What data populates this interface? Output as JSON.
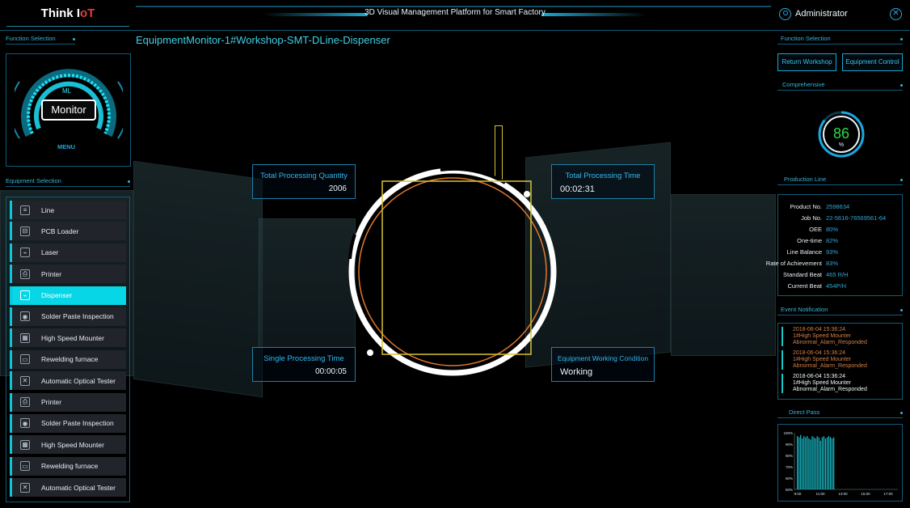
{
  "header": {
    "logo_main": "Think I",
    "logo_accent": "oT",
    "platform_title": "3D Visual Management Platform for Smart Factory",
    "user_name": "Administrator"
  },
  "page_title": "EquipmentMonitor-1#Workshop-SMT-DLine-Dispenser",
  "left": {
    "function_selection": "Function Selection",
    "menu_ml": "ML",
    "menu_monitor": "Monitor",
    "menu_label": "MENU",
    "equipment_selection": "Equipment Selection",
    "equipment": [
      {
        "label": "Line",
        "icon": "line-icon",
        "glyph": "≡"
      },
      {
        "label": "PCB Loader",
        "icon": "pcb-loader-icon",
        "glyph": "⊟"
      },
      {
        "label": "Laser",
        "icon": "laser-icon",
        "glyph": "⌁"
      },
      {
        "label": "Printer",
        "icon": "printer-icon",
        "glyph": "⎙"
      },
      {
        "label": "Dispenser",
        "icon": "dispenser-icon",
        "glyph": "⌁"
      },
      {
        "label": "Solder Paste Inspection",
        "icon": "inspection-icon",
        "glyph": "◉"
      },
      {
        "label": "High Speed Mounter",
        "icon": "mounter-icon",
        "glyph": "▦"
      },
      {
        "label": "Rewelding furnace",
        "icon": "furnace-icon",
        "glyph": "▭"
      },
      {
        "label": "Automatic Optical Tester",
        "icon": "optical-tester-icon",
        "glyph": "✕"
      },
      {
        "label": "Printer",
        "icon": "printer-icon",
        "glyph": "⎙"
      },
      {
        "label": "Solder Paste Inspection",
        "icon": "inspection-icon",
        "glyph": "◉"
      },
      {
        "label": "High Speed Mounter",
        "icon": "mounter-icon",
        "glyph": "▦"
      },
      {
        "label": "Rewelding furnace",
        "icon": "furnace-icon",
        "glyph": "▭"
      },
      {
        "label": "Automatic Optical Tester",
        "icon": "optical-tester-icon",
        "glyph": "✕"
      }
    ],
    "active_index": 4
  },
  "center": {
    "total_qty_title": "Total Processing Quantity",
    "total_qty_value": "2006",
    "total_time_title": "Total Processing Time",
    "total_time_value": "00:02:31",
    "single_time_title": "Single Processing Time",
    "single_time_value": "00:00:05",
    "condition_title": "Equipment Working Condition",
    "condition_value": "Working"
  },
  "right": {
    "function_selection": "Function Selection",
    "return_workshop": "Return Workshop",
    "equipment_control": "Equipment Control",
    "comprehensive": "Comprehensive",
    "gauge_value": "86",
    "gauge_unit": "%",
    "gauge_fraction": 0.86,
    "production_line": "Production Line",
    "production": [
      {
        "k": "Product No.",
        "v": "2598634"
      },
      {
        "k": "Job No.",
        "v": "22-5616-76569561-64"
      },
      {
        "k": "OEE",
        "v": "80%"
      },
      {
        "k": "One-time",
        "v": "82%"
      },
      {
        "k": "Line Balance",
        "v": "93%"
      },
      {
        "k": "Rate of Achievement",
        "v": "83%"
      },
      {
        "k": "Standard Beat",
        "v": "465 R/H"
      },
      {
        "k": "Current Beat",
        "v": "454P/H"
      }
    ],
    "event_notification": "Event Notification",
    "events": [
      {
        "time": "2018-06-04 15:36:24",
        "device": "1#High Speed Mounter",
        "msg": "Abnormal_Alarm_Responded",
        "color": "orange"
      },
      {
        "time": "2018-06-04 15:36:24",
        "device": "1#High Speed Mounter",
        "msg": "Abnormal_Alarm_Responded",
        "color": "orange"
      },
      {
        "time": "2018-06-04 15:36:24",
        "device": "1#High Speed Mounter",
        "msg": "Abnormal_Alarm_Responded",
        "color": "white"
      }
    ],
    "direct_pass": "Direct Pass",
    "chart_data": {
      "type": "bar",
      "y_ticks": [
        "100%",
        "90%",
        "80%",
        "70%",
        "60%",
        "50%"
      ],
      "x_ticks": [
        "9:00",
        "11:00",
        "13:00",
        "15:00",
        "17:00"
      ],
      "ylim": [
        50,
        100
      ],
      "values": [
        97,
        96,
        98,
        95,
        97,
        96,
        97,
        95,
        94,
        97,
        96,
        95,
        97,
        96,
        93,
        96,
        97,
        95,
        96,
        97,
        96,
        95,
        96
      ]
    }
  },
  "colors": {
    "accent": "#10c6d6",
    "gauge_text": "#2fd84a",
    "orange": "#cf7f45"
  }
}
